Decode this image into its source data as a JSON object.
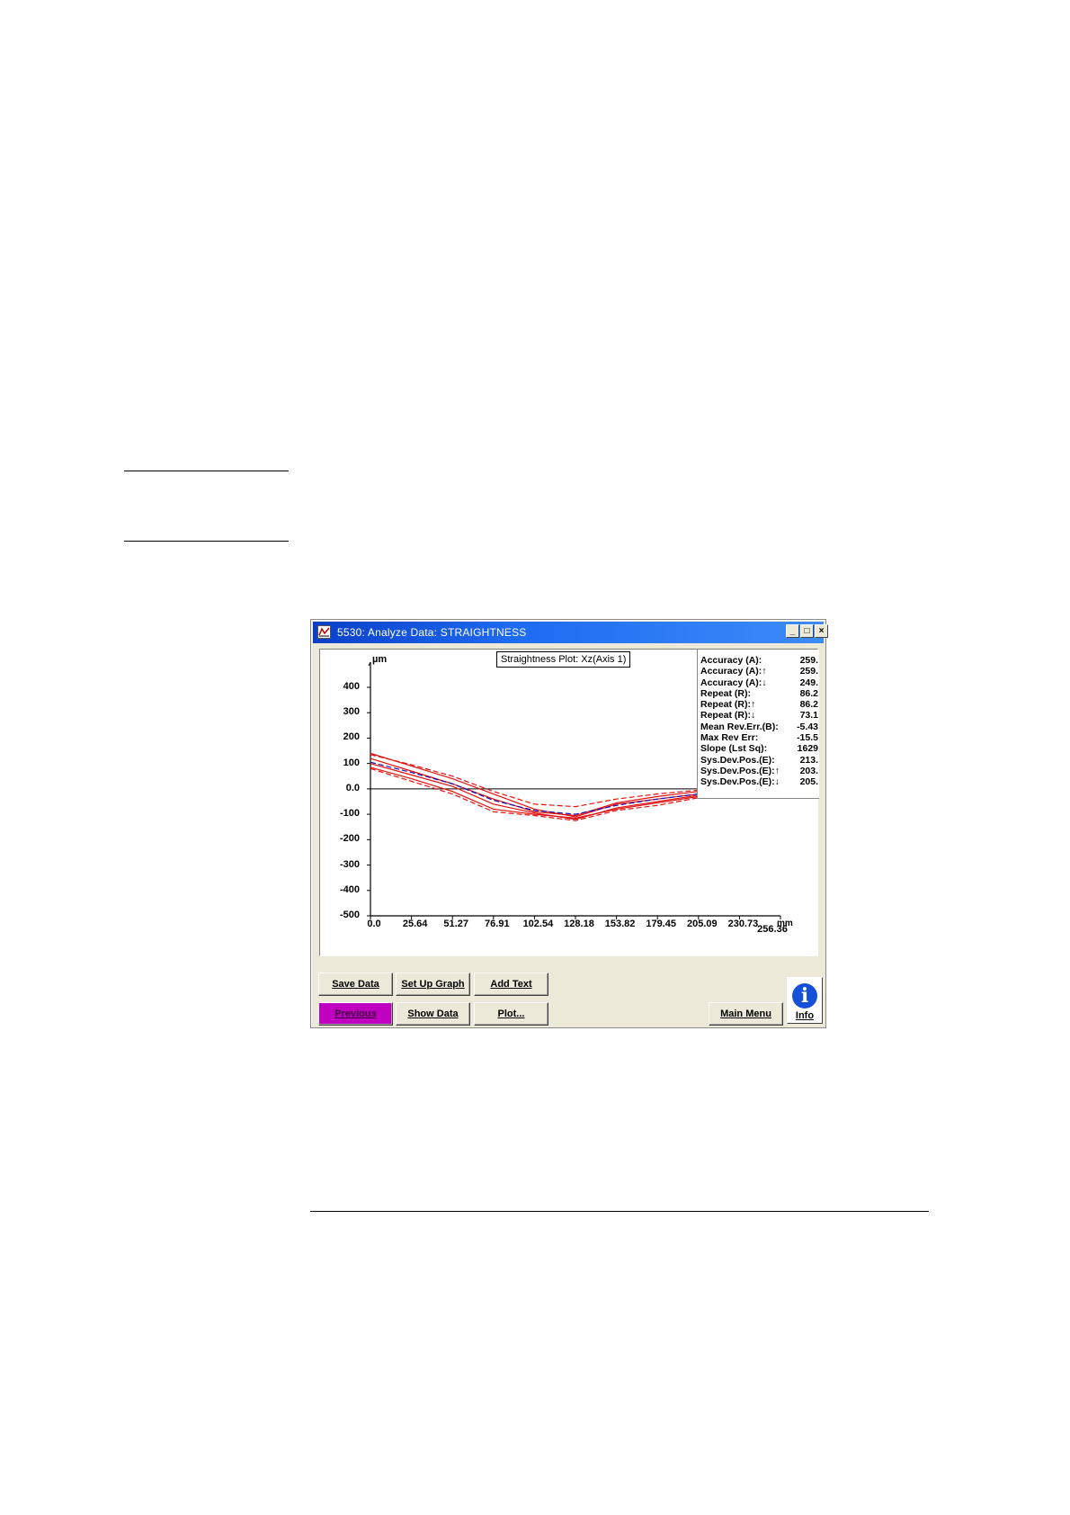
{
  "window": {
    "title": "5530: Analyze Data: STRAIGHTNESS",
    "minimize_glyph": "_",
    "maximize_glyph": "□",
    "close_glyph": "×"
  },
  "plot": {
    "title": "Straightness Plot: Xz(Axis  1)",
    "y_unit": "µm",
    "x_unit": "mm"
  },
  "stats": {
    "header_fragment": "----------------",
    "rows": [
      {
        "label": "Accuracy (A):",
        "value": "259."
      },
      {
        "label": "Accuracy (A):↑",
        "value": "259."
      },
      {
        "label": "Accuracy (A):↓",
        "value": "249."
      },
      {
        "label": "Repeat (R):",
        "value": "86.2"
      },
      {
        "label": "Repeat (R):↑",
        "value": "86.2"
      },
      {
        "label": "Repeat (R):↓",
        "value": "73.1"
      },
      {
        "label": "Mean Rev.Err.(B):",
        "value": "-5.43"
      },
      {
        "label": "Max Rev Err:",
        "value": "-15.5"
      },
      {
        "label": "Slope (Lst Sq):",
        "value": "1629"
      },
      {
        "label": "Sys.Dev.Pos.(E):",
        "value": "213."
      },
      {
        "label": "Sys.Dev.Pos.(E):↑",
        "value": "203."
      },
      {
        "label": "Sys.Dev.Pos.(E):↓",
        "value": "205."
      }
    ]
  },
  "buttons": {
    "save_data": "Save Data",
    "set_up_graph": "Set Up Graph",
    "add_text": "Add Text",
    "previous": "Previous",
    "show_data": "Show Data",
    "plot": "Plot...",
    "main_menu": "Main Menu",
    "info": "Info",
    "info_glyph": "i"
  },
  "colors": {
    "run_lines": "#e01010",
    "mean_line": "#1010c0",
    "previous_button": "#c000c0",
    "title_bar": "#1f6bf2"
  },
  "chart_data": {
    "type": "line",
    "title": "Straightness Plot: Xz(Axis  1)",
    "xlabel": "mm",
    "ylabel": "µm",
    "ylim": [
      -500,
      400
    ],
    "xlim": [
      0,
      256.36
    ],
    "y_ticks": [
      "400",
      "300",
      "200",
      "100",
      "0.0",
      "-100",
      "-200",
      "-300",
      "-400",
      "-500"
    ],
    "x_ticks": [
      "0.0",
      "25.64",
      "51.27",
      "76.91",
      "102.54",
      "128.18",
      "153.82",
      "179.45",
      "205.09",
      "230.73",
      "256.36"
    ],
    "x_tick_values": [
      0,
      25.64,
      51.27,
      76.91,
      102.54,
      128.18,
      153.82,
      179.45,
      205.09,
      230.73,
      256.36
    ],
    "x": [
      0,
      25.64,
      51.27,
      76.91,
      102.54,
      128.18,
      153.82,
      179.45,
      205.09,
      230.73
    ],
    "series": [
      {
        "values": [
          140,
          90,
          40,
          -20,
          -80,
          -110,
          -60,
          -40,
          -20,
          0
        ],
        "style": "solid",
        "color": "#e01010"
      },
      {
        "values": [
          120,
          70,
          20,
          -40,
          -90,
          -105,
          -55,
          -30,
          -10,
          5
        ],
        "style": "solid",
        "color": "#e01010"
      },
      {
        "values": [
          100,
          55,
          10,
          -60,
          -95,
          -120,
          -75,
          -50,
          -25,
          0
        ],
        "style": "solid",
        "color": "#e01010"
      },
      {
        "values": [
          85,
          40,
          -10,
          -80,
          -100,
          -115,
          -80,
          -55,
          -30,
          0
        ],
        "style": "solid",
        "color": "#e01010"
      },
      {
        "values": [
          135,
          95,
          50,
          -10,
          -60,
          -70,
          -40,
          -20,
          -5,
          5
        ],
        "style": "dashed",
        "color": "#e01010"
      },
      {
        "values": [
          80,
          30,
          -20,
          -90,
          -105,
          -125,
          -85,
          -65,
          -35,
          0
        ],
        "style": "dashed",
        "color": "#e01010"
      },
      {
        "values": [
          105,
          65,
          20,
          -45,
          -85,
          -100,
          -65,
          -40,
          -20,
          0
        ],
        "style": "dashed",
        "color": "#1010c0"
      }
    ],
    "grid": false,
    "legend": "none"
  }
}
